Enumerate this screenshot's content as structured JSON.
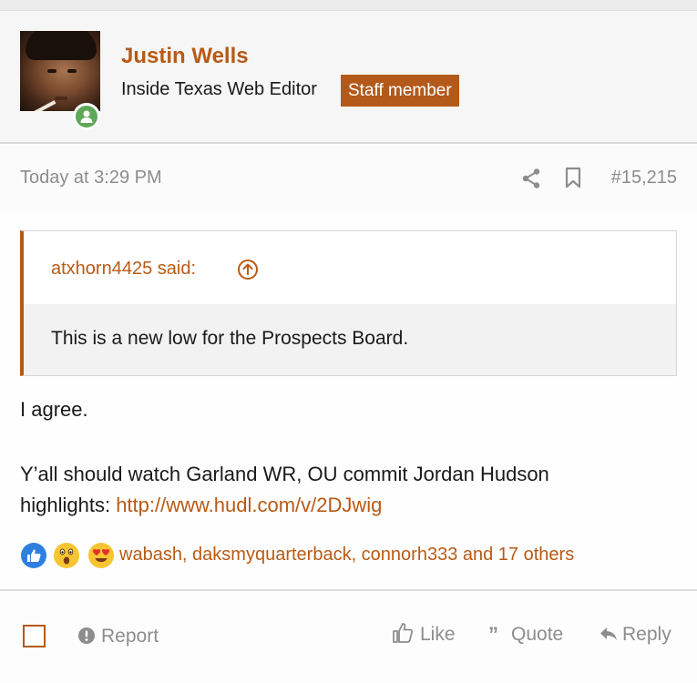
{
  "user": {
    "name": "Justin Wells",
    "title": "Inside Texas Web Editor",
    "badge": "Staff member"
  },
  "post": {
    "timestamp": "Today at 3:29 PM",
    "number": "#15,215"
  },
  "quote": {
    "author_said": "atxhorn4425 said:",
    "text": "This is a new low for the Prospects Board."
  },
  "message": {
    "line1": "I agree.",
    "line2": "Y’all should watch Garland WR, OU commit Jordan Hudson",
    "line3_text": "highlights: ",
    "link": "http://www.hudl.com/v/2DJwig"
  },
  "reactions": {
    "icons": [
      "like-reaction-icon",
      "wow-reaction-icon",
      "love-reaction-icon"
    ],
    "names": "wabash, daksmyquarterback, connorh333 and 17 others"
  },
  "actions": {
    "report": "Report",
    "like": "Like",
    "quote": "Quote",
    "reply": "Reply"
  },
  "colors": {
    "accent": "#b35a1a",
    "muted": "#8d8d8d",
    "online": "#5fa85a"
  }
}
